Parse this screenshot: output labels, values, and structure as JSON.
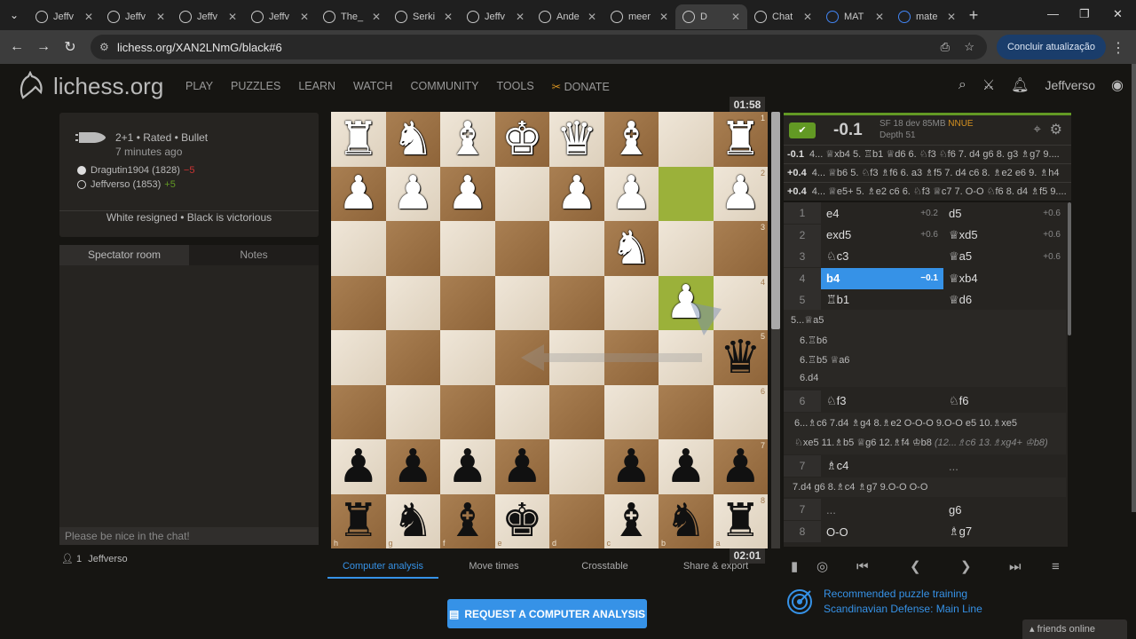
{
  "browser": {
    "tabs": [
      {
        "label": "Jeffv",
        "type": "lichess"
      },
      {
        "label": "Jeffv",
        "type": "lichess"
      },
      {
        "label": "Jeffv",
        "type": "lichess"
      },
      {
        "label": "Jeffv",
        "type": "lichess"
      },
      {
        "label": "The_",
        "type": "lichess"
      },
      {
        "label": "Serki",
        "type": "lichess"
      },
      {
        "label": "Jeffv",
        "type": "lichess"
      },
      {
        "label": "Ande",
        "type": "lichess"
      },
      {
        "label": "meer",
        "type": "lichess"
      },
      {
        "label": "D",
        "type": "lichess",
        "active": true
      },
      {
        "label": "Chat",
        "type": "chatgpt"
      },
      {
        "label": "MAT",
        "type": "google"
      },
      {
        "label": "mate",
        "type": "google"
      }
    ],
    "url": "lichess.org/XAN2LNmG/black#6",
    "update_button": "Concluir atualização"
  },
  "site": {
    "logo_text": "lichess.org",
    "nav": [
      "PLAY",
      "PUZZLES",
      "LEARN",
      "WATCH",
      "COMMUNITY",
      "TOOLS"
    ],
    "donate": "DONATE",
    "username": "Jeffverso"
  },
  "game": {
    "type": "2+1 • Rated • Bullet",
    "time_ago": "7 minutes ago",
    "white_player": "Dragutin1904 (1828)",
    "white_diff": "−5",
    "black_player": "Jeffverso (1853)",
    "black_diff": "+5",
    "result": "White resigned • Black is victorious"
  },
  "chat": {
    "tab_spectator": "Spectator room",
    "tab_notes": "Notes",
    "placeholder": "Please be nice in the chat!",
    "watchers_count": "1",
    "watcher": "Jeffverso"
  },
  "clocks": {
    "top": "01:58",
    "bottom": "02:01"
  },
  "board": {
    "ranks": [
      [
        "wR",
        "wN",
        "wB",
        "wK",
        "wQ",
        "wB",
        "",
        "wR"
      ],
      [
        "wP",
        "wP",
        "wP",
        "",
        "wP",
        "wP",
        "",
        "wP"
      ],
      [
        "",
        "",
        "",
        "",
        "",
        "wN",
        "",
        ""
      ],
      [
        "",
        "",
        "",
        "",
        "",
        "",
        "wP",
        ""
      ],
      [
        "",
        "",
        "",
        "",
        "",
        "",
        "",
        "bQ"
      ],
      [
        "",
        "",
        "",
        "",
        "",
        "",
        "",
        ""
      ],
      [
        "bP",
        "bP",
        "bP",
        "bP",
        "",
        "bP",
        "bP",
        "bP"
      ],
      [
        "bR",
        "bN",
        "bB",
        "bK",
        "",
        "bB",
        "bN",
        "bR"
      ]
    ],
    "rank_labels": [
      "1",
      "2",
      "3",
      "4",
      "5",
      "6",
      "7",
      "8"
    ],
    "file_labels": [
      "h",
      "g",
      "f",
      "e",
      "d",
      "c",
      "b",
      "a"
    ],
    "highlights": [
      [
        1,
        6
      ],
      [
        3,
        6
      ]
    ]
  },
  "underboard": {
    "tabs": [
      "Computer analysis",
      "Move times",
      "Crosstable",
      "Share & export"
    ],
    "request_button": "REQUEST A COMPUTER ANALYSIS"
  },
  "analysis": {
    "eval": "-0.1",
    "engine": "SF 18 dev 85MB",
    "nnue": "NNUE",
    "depth": "Depth 51",
    "pv": [
      {
        "score": "-0.1",
        "line": "4... ♕xb4 5. ♖b1 ♕d6 6. ♘f3 ♘f6 7. d4 g6 8. g3 ♗g7 9...."
      },
      {
        "score": "+0.4",
        "line": "4... ♕b6 5. ♘f3 ♗f6 6. a3 ♗f5 7. d4 c6 8. ♗e2 e6 9. ♗h4"
      },
      {
        "score": "+0.4",
        "line": "4... ♕e5+ 5. ♗e2 c6 6. ♘f3 ♕c7 7. O-O ♘f6 8. d4 ♗f5 9...."
      }
    ],
    "moves": [
      {
        "n": "1",
        "w": "e4",
        "we": "+0.2",
        "b": "d5",
        "be": "+0.6"
      },
      {
        "n": "2",
        "w": "exd5",
        "we": "+0.6",
        "b": "♕xd5",
        "be": "+0.6"
      },
      {
        "n": "3",
        "w": "♘c3",
        "we": "",
        "b": "♕a5",
        "be": "+0.6"
      },
      {
        "n": "4",
        "w": "b4",
        "we": "−0.1",
        "b": "♕xb4",
        "be": ""
      },
      {
        "n": "5",
        "w": "♖b1",
        "we": "",
        "b": "♕d6",
        "be": ""
      }
    ],
    "var1": [
      "5...♕a5",
      "6.♖b6",
      "6.♖b5 ♕a6",
      "6.d4"
    ],
    "move6": {
      "n": "6",
      "w": "♘f3",
      "b": "♘f6"
    },
    "var2_line1": "6...♗c6 7.d4 ♗g4 8.♗e2 O-O-O 9.O-O e5 10.♗xe5",
    "var2_line2a": "♘xe5 11.♗b5 ♕g6 12.♗f4 ♔b8",
    "var2_line2b": "(12...♗c6 13.♗xg4+ ♔b8)",
    "move7": {
      "n": "7",
      "w": "♗c4",
      "b": "..."
    },
    "var3": "7.d4 g6 8.♗c4 ♗g7 9.O-O O-O",
    "move7b": {
      "n": "7",
      "w": "...",
      "b": "g6"
    },
    "move8": {
      "n": "8",
      "w": "O-O",
      "b": "♗g7"
    }
  },
  "puzzle": {
    "title": "Recommended puzzle training",
    "theme": "Scandinavian Defense: Main Line"
  },
  "friends": "friends online"
}
